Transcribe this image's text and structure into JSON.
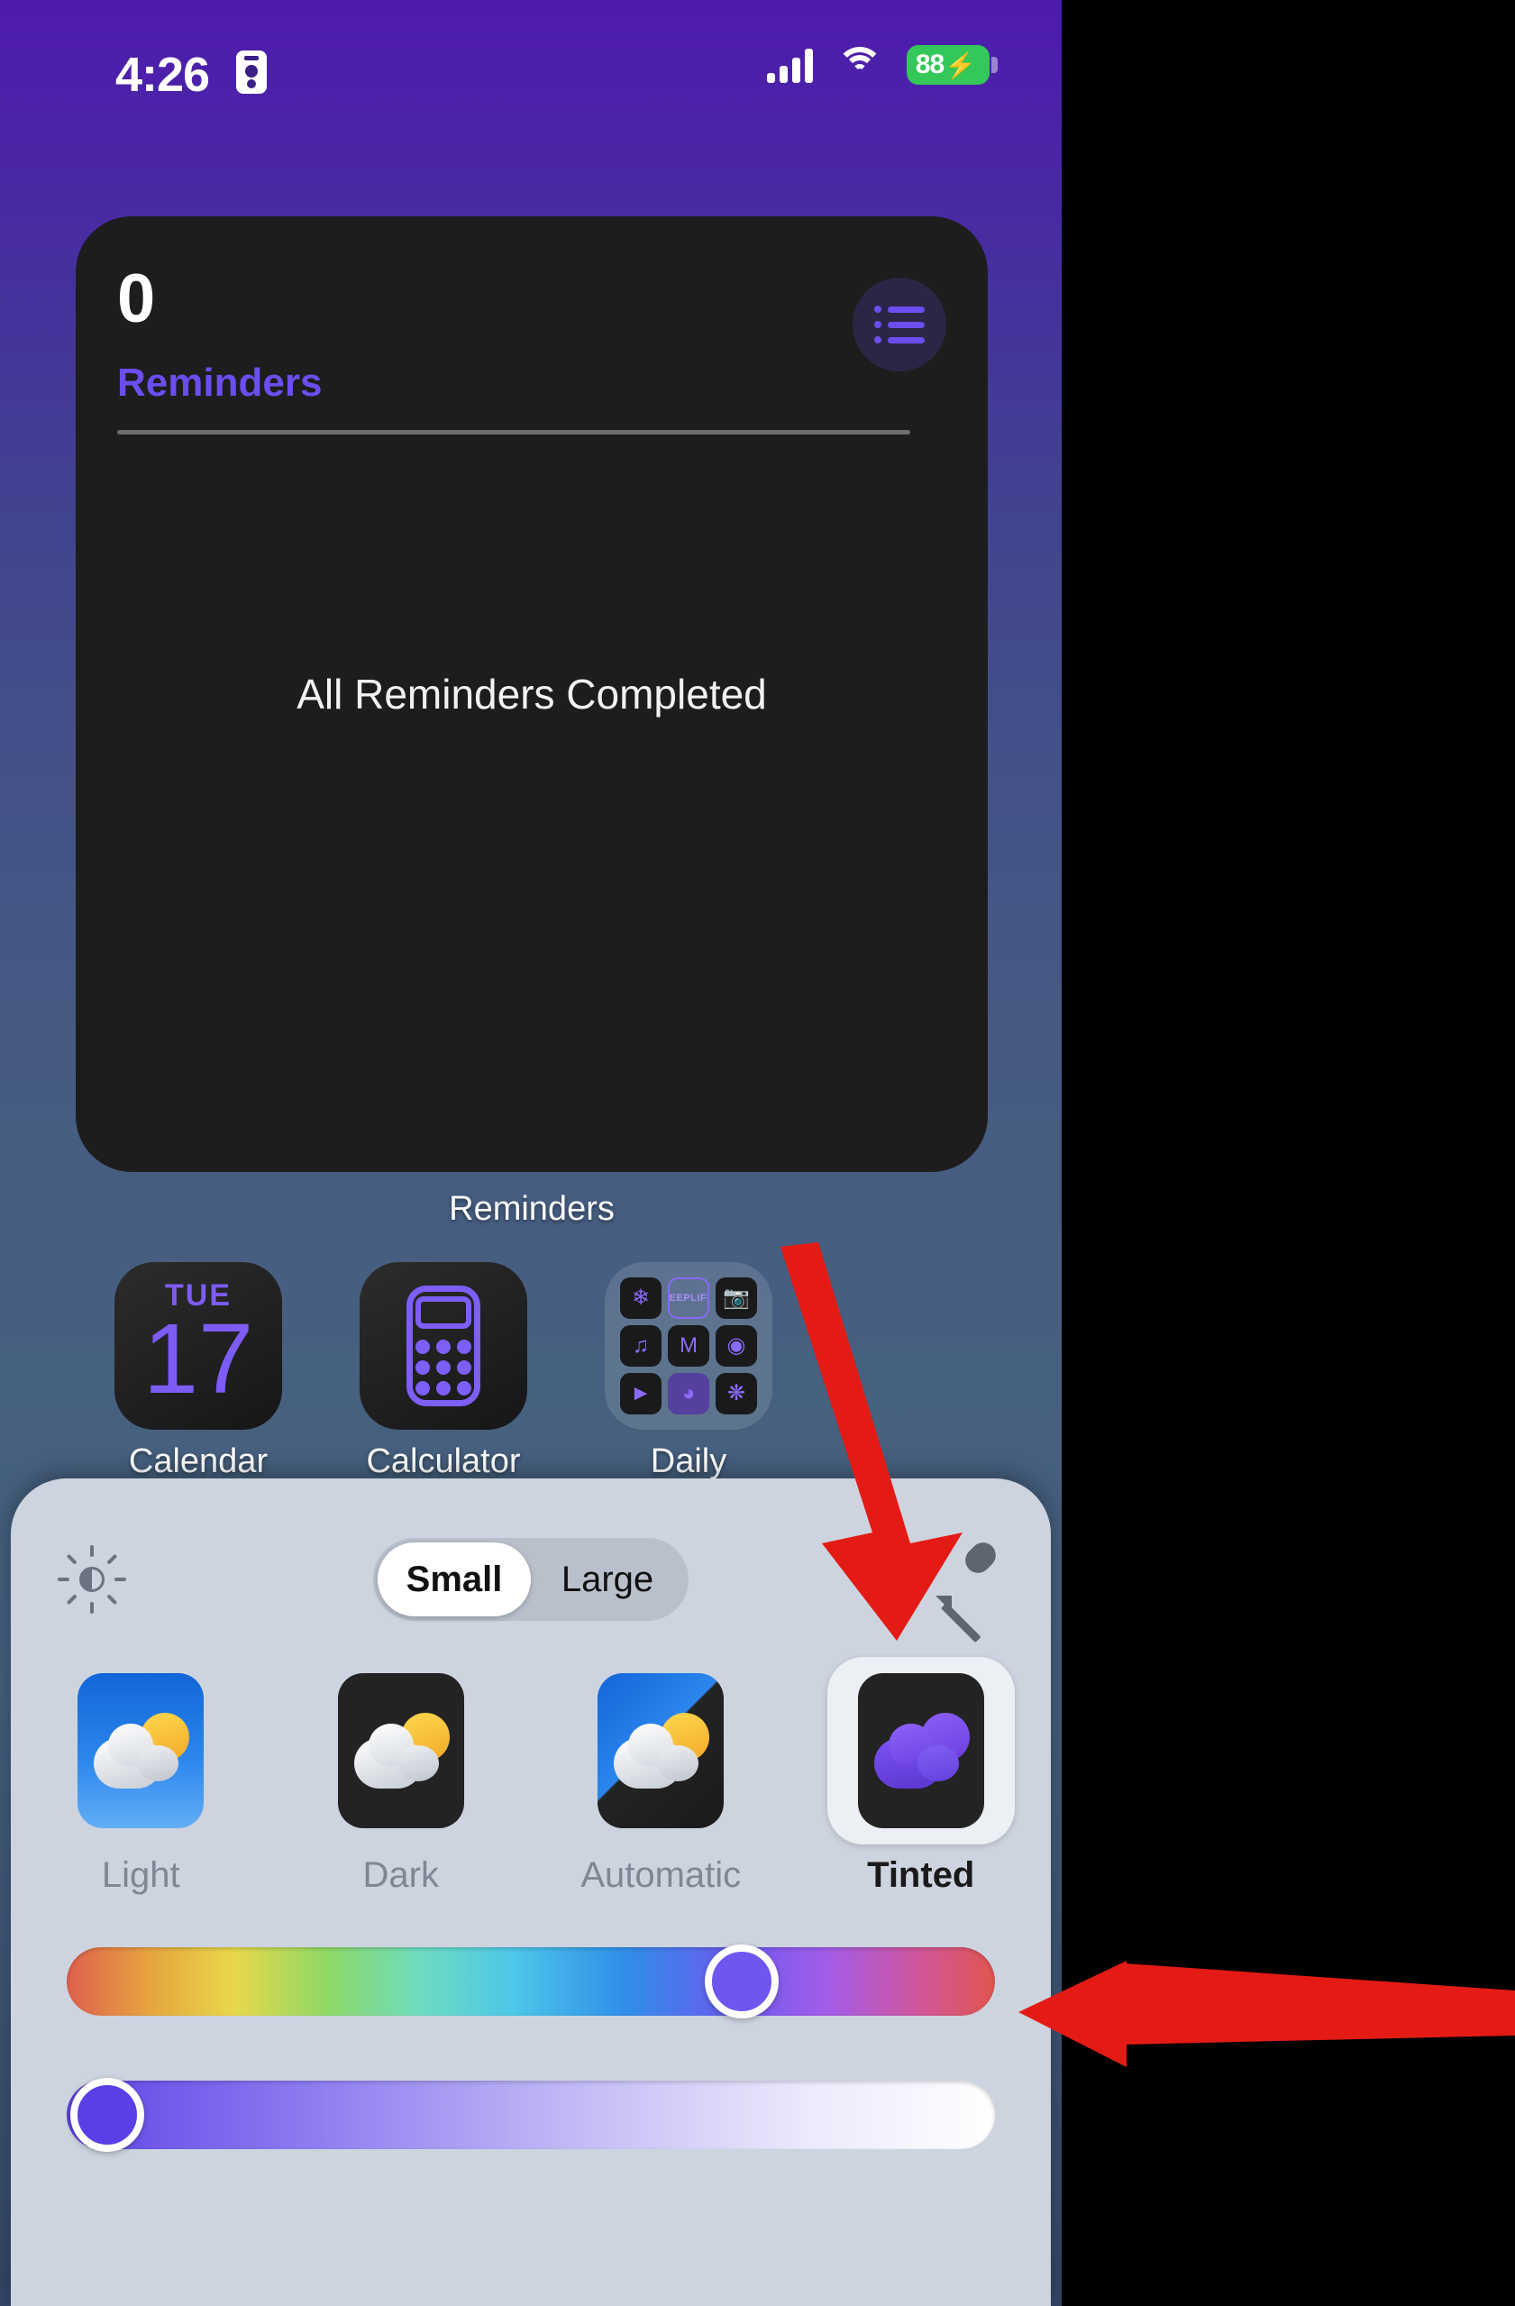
{
  "status_bar": {
    "time": "4:26",
    "recording_icon": "screen-record-icon",
    "signal_icon": "cellular-signal-icon",
    "wifi_icon": "wifi-icon",
    "battery_percent": "88",
    "battery_bolt": "⚡",
    "battery_color": "#34c759"
  },
  "widget": {
    "count": "0",
    "title": "Reminders",
    "title_color": "#6b4df0",
    "empty_message": "All Reminders Completed",
    "list_button_icon": "bulleted-list-icon",
    "label": "Reminders"
  },
  "apps": [
    {
      "name": "Calendar",
      "icon": "calendar-icon",
      "dow": "TUE",
      "day": "17"
    },
    {
      "name": "Calculator",
      "icon": "calculator-icon"
    },
    {
      "name": "Daily",
      "icon": "folder-icon",
      "mini_icons": [
        "flower-icon",
        "jeeplife-icon",
        "camera-icon",
        "music-note-icon",
        "gmail-icon",
        "chrome-icon",
        "video-camera-icon",
        "app-icon",
        "openai-icon"
      ],
      "mini_labels": [
        "",
        "JEEPLIFE",
        "",
        "",
        "M",
        "",
        "",
        "",
        ""
      ]
    }
  ],
  "panel": {
    "brightness_icon": "brightness-icon",
    "eyedropper_icon": "eyedropper-icon",
    "size_options": [
      {
        "label": "Small",
        "selected": true
      },
      {
        "label": "Large",
        "selected": false
      }
    ],
    "themes": [
      {
        "label": "Light",
        "selected": false,
        "swatch": "light-swatch"
      },
      {
        "label": "Dark",
        "selected": false,
        "swatch": "dark-swatch"
      },
      {
        "label": "Automatic",
        "selected": false,
        "swatch": "automatic-swatch"
      },
      {
        "label": "Tinted",
        "selected": true,
        "swatch": "tinted-swatch"
      }
    ],
    "sliders": [
      {
        "name": "hue-slider",
        "knob_color": "#6e57ee",
        "knob_position_pct": 70
      },
      {
        "name": "saturation-slider",
        "knob_color": "#5b3fe6",
        "knob_position_pct": 0
      }
    ],
    "background_color": "#ced4df"
  },
  "annotations": [
    {
      "name": "arrow-pointing-to-tinted",
      "color": "#e41b15",
      "direction": "down-right"
    },
    {
      "name": "arrow-pointing-to-hue-slider",
      "color": "#e41b15",
      "direction": "left"
    }
  ]
}
